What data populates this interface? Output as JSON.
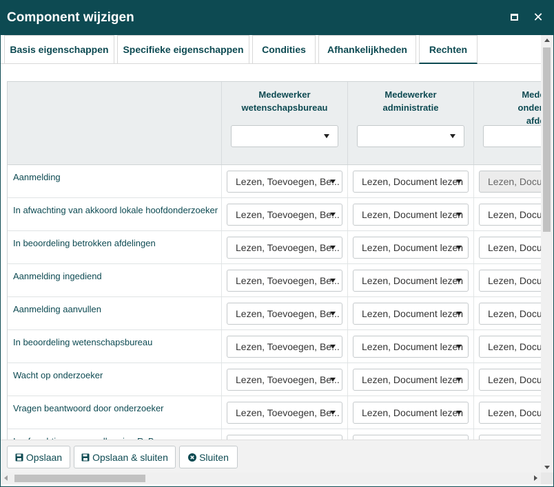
{
  "dialog": {
    "title": "Component wijzigen",
    "maximize_icon": "maximize-icon",
    "close_icon": "close-icon",
    "close_glyph": "✕"
  },
  "tabs": [
    {
      "label": "Basis eigenschappen",
      "active": false
    },
    {
      "label": "Specifieke eigenschappen",
      "active": false
    },
    {
      "label": "Condities",
      "active": false
    },
    {
      "label": "Afhankelijkheden",
      "active": false
    },
    {
      "label": "Rechten",
      "active": true
    }
  ],
  "grid": {
    "columns": [
      {
        "label_line1": "Medewerker",
        "label_line2": "wetenschapsbureau",
        "label_line3": "",
        "filter_value": ""
      },
      {
        "label_line1": "Medewerker",
        "label_line2": "administratie",
        "label_line3": "",
        "filter_value": ""
      },
      {
        "label_line1": "Medew",
        "label_line2": "onderste",
        "label_line3": "afdel",
        "filter_value": ""
      }
    ],
    "rows": [
      {
        "label": "Aanmelding",
        "values": [
          "Lezen, Toevoegen, Be...",
          "Lezen, Document lezen",
          "Lezen, Docum"
        ],
        "disabled": [
          false,
          false,
          true
        ]
      },
      {
        "label": "In afwachting van akkoord lokale hoofdonderzoeker",
        "values": [
          "Lezen, Toevoegen, Be...",
          "Lezen, Document lezen",
          "Lezen, Docum"
        ],
        "disabled": [
          false,
          false,
          false
        ]
      },
      {
        "label": "In beoordeling betrokken afdelingen",
        "values": [
          "Lezen, Toevoegen, Be...",
          "Lezen, Document lezen",
          "Lezen, Docum"
        ],
        "disabled": [
          false,
          false,
          false
        ]
      },
      {
        "label": "Aanmelding ingediend",
        "values": [
          "Lezen, Toevoegen, Be...",
          "Lezen, Document lezen",
          "Lezen, Docum"
        ],
        "disabled": [
          false,
          false,
          false
        ]
      },
      {
        "label": "Aanmelding aanvullen",
        "values": [
          "Lezen, Toevoegen, Be...",
          "Lezen, Document lezen",
          "Lezen, Docum"
        ],
        "disabled": [
          false,
          false,
          false
        ]
      },
      {
        "label": "In beoordeling wetenschapsbureau",
        "values": [
          "Lezen, Toevoegen, Be...",
          "Lezen, Document lezen",
          "Lezen, Docum"
        ],
        "disabled": [
          false,
          false,
          false
        ]
      },
      {
        "label": "Wacht op onderzoeker",
        "values": [
          "Lezen, Toevoegen, Be...",
          "Lezen, Document lezen",
          "Lezen, Docum"
        ],
        "disabled": [
          false,
          false,
          false
        ]
      },
      {
        "label": "Vragen beantwoord door onderzoeker",
        "values": [
          "Lezen, Toevoegen, Be...",
          "Lezen, Document lezen",
          "Lezen, Docum"
        ],
        "disabled": [
          false,
          false,
          false
        ]
      },
      {
        "label": "In afwachting van goedkeuring RvB",
        "values": [
          "",
          "",
          ""
        ],
        "disabled": [
          false,
          false,
          false
        ]
      }
    ]
  },
  "footer": {
    "buttons": [
      {
        "label": "Opslaan",
        "icon": "save-icon"
      },
      {
        "label": "Opslaan & sluiten",
        "icon": "save-icon"
      },
      {
        "label": "Sluiten",
        "icon": "close-circle-icon"
      }
    ]
  },
  "colors": {
    "primary": "#0d4a52",
    "header_bg": "#ebeeef"
  }
}
